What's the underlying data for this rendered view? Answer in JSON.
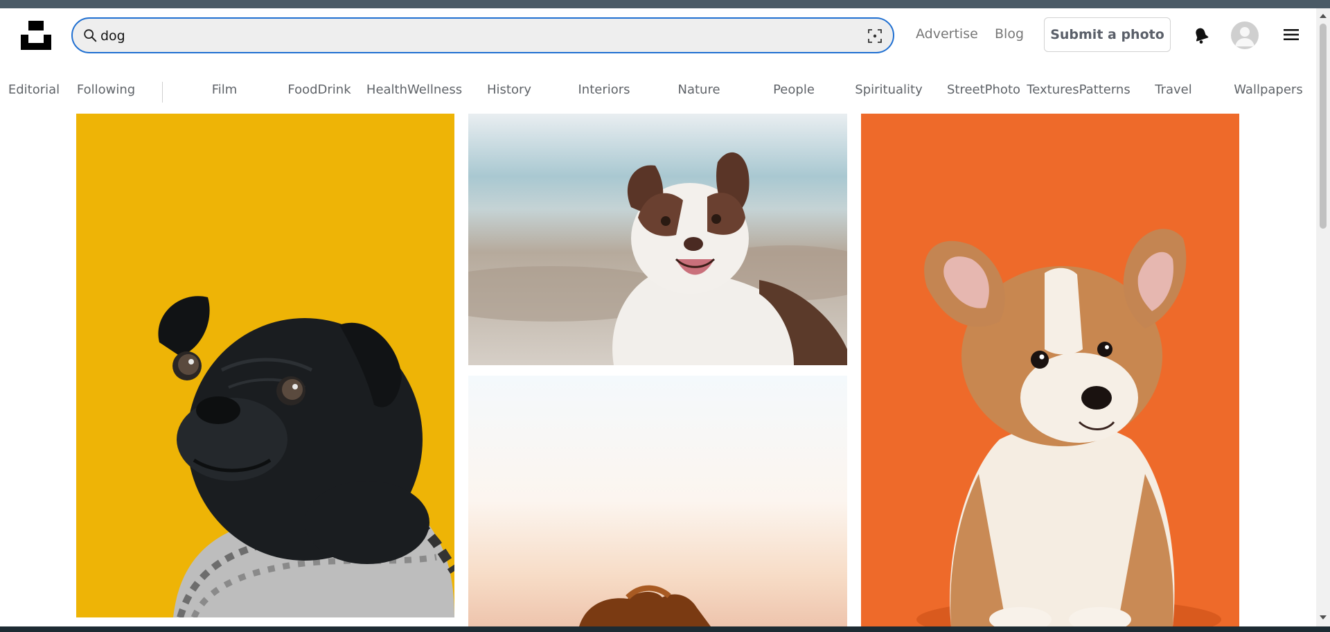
{
  "header": {
    "search_value": "dog",
    "nav": {
      "advertise": "Advertise",
      "blog": "Blog",
      "submit": "Submit a photo"
    }
  },
  "topics": [
    "Editorial",
    "Following",
    "Film",
    "FoodDrink",
    "HealthWellness",
    "History",
    "Interiors",
    "Nature",
    "People",
    "Spirituality",
    "StreetPhoto",
    "TexturesPatterns",
    "Travel",
    "Wallpapers"
  ],
  "photos": [
    {
      "subject": "pug-in-sweater",
      "background": "#eeb406"
    },
    {
      "subject": "australian-shepherd-on-beach",
      "background": "#c8c3bb"
    },
    {
      "subject": "dog-at-sunset",
      "background": "#fbf4ee"
    },
    {
      "subject": "corgi-puppy",
      "background": "#ee6a2a"
    }
  ],
  "colors": {
    "accent": "#1f6fd1",
    "search_bg": "#eeeeee",
    "text": "#767676"
  }
}
